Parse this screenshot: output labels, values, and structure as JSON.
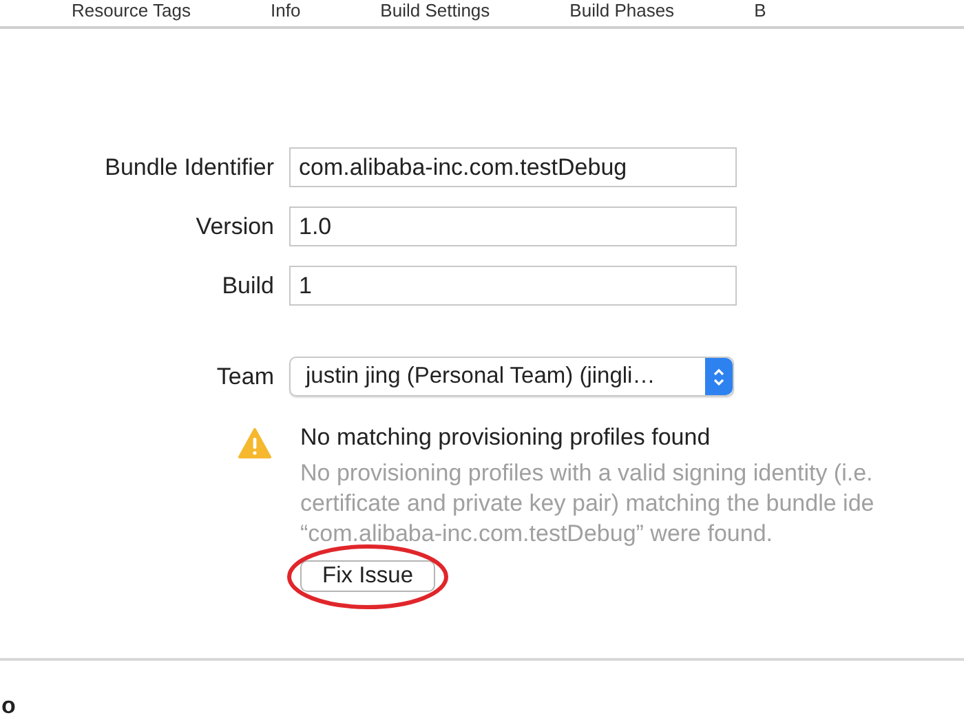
{
  "tabs": [
    {
      "label": "Resource Tags",
      "selected": false
    },
    {
      "label": "Info",
      "selected": false
    },
    {
      "label": "Build Settings",
      "selected": false
    },
    {
      "label": "Build Phases",
      "selected": false
    },
    {
      "label": "B",
      "selected": false
    }
  ],
  "fields": [
    {
      "label": "Bundle Identifier",
      "value": "com.alibaba-inc.com.testDebug"
    },
    {
      "label": "Version",
      "value": "1.0"
    },
    {
      "label": "Build",
      "value": "1"
    }
  ],
  "team": {
    "label": "Team",
    "value": "justin jing (Personal Team) (jingli…"
  },
  "warning": {
    "title": "No matching provisioning profiles found",
    "lines": [
      "No provisioning profiles with a valid signing identity (i.e.",
      "certificate and private key pair) matching the bundle ide",
      "“com.alibaba-inc.com.testDebug” were found."
    ],
    "button": "Fix Issue"
  },
  "next_section": {
    "title": "o"
  }
}
